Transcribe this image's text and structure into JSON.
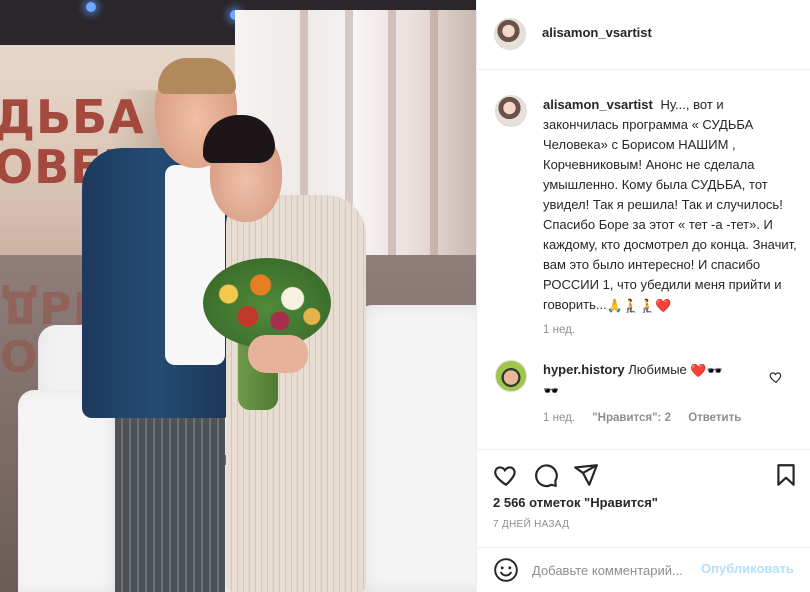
{
  "post": {
    "author": "alisamon_vsartist",
    "image_alt": "Photo",
    "photo_wall_text": "СУДЬБА ЧЕЛОВЕКА"
  },
  "caption": {
    "username": "alisamon_vsartist",
    "text": "Ну..., вот и закончилась программа « СУДЬБА Человека» с Борисом НАШИМ , Корчевниковым! Анонс не сделала умышленно. Кому была СУДЬБА, тот увидел! Так я решила! Так и случилось! Спасибо Боре за этот « тет -а -тет». И каждому, кто досмотрел до конца. Значит, вам это было интересно! И спасибо РОССИИ 1, что убедили меня прийти и говорить...",
    "emojis": "🙏🧎🧎❤️",
    "time": "1 нед."
  },
  "reply": {
    "username": "hyper.history",
    "text": "Любимые",
    "emojis": "❤️🕶️",
    "emoji_line2": "🕶️",
    "time": "1 нед.",
    "likes": "\"Нравится\": 2",
    "reply_label": "Ответить",
    "like_icon": "heart-outline-icon"
  },
  "actions": {
    "like_icon": "heart-outline-icon",
    "comment_icon": "comment-icon",
    "share_icon": "share-icon",
    "save_icon": "bookmark-icon",
    "likes_text": "2 566 отметок \"Нравится\"",
    "date_text": "7 ДНЕЙ НАЗАД"
  },
  "comment_box": {
    "placeholder": "Добавьте комментарий...",
    "post_label": "Опубликовать",
    "emoji_icon": "smile-icon"
  },
  "colors": {
    "text": "#262626",
    "muted": "#8e8e8e",
    "link_disabled": "#b2dffc",
    "border": "#efefef",
    "heart": "#ed4956"
  }
}
